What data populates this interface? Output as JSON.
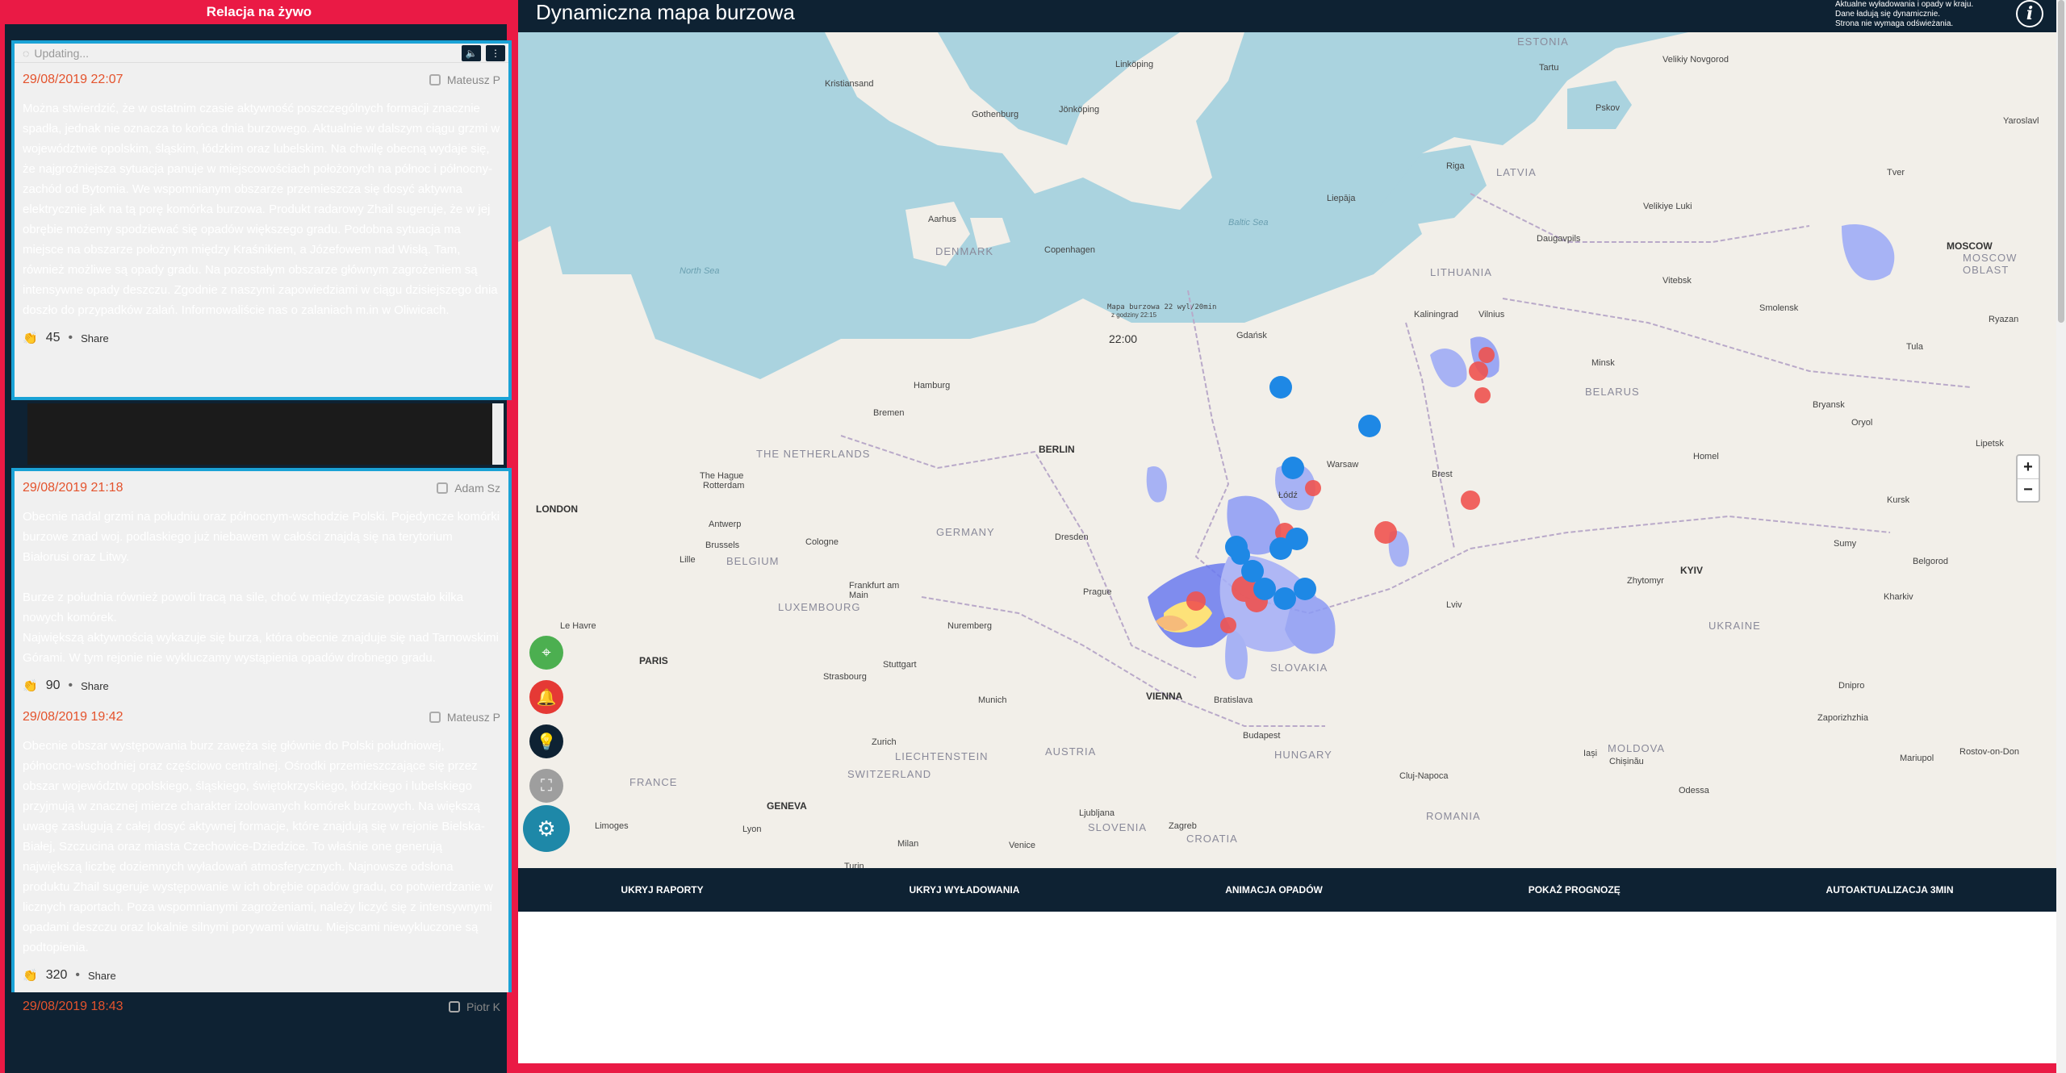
{
  "live": {
    "header": "Relacja na żywo",
    "updating": "Updating...",
    "posts_top": [
      {
        "date": "29/08/2019 22:07",
        "author": "Mateusz P",
        "body": "Można stwierdzić, że w ostatnim czasie aktywność poszczególnych formacji znacznie spadła, jednak nie oznacza to końca dnia burzowego. Aktualnie w dalszym ciągu grzmi w województwie opolskim, śląskim, łódzkim oraz lubelskim. Na chwilę obecną wydaje się, że najgroźniejsza sytuacja panuje w miejscowościach położonych na północ i północny-zachód od Bytomia. We wspomnianym obszarze przemieszcza się dosyć aktywna elektrycznie jak na tą porę komórka burzowa. Produkt radarowy Zhail sugeruje, że w jej obrębie możemy spodziewać się opadów większego gradu. Podobna sytuacja ma miejsce na obszarze położnym między Kraśnikiem, a Józefowem nad Wisłą. Tam, również możliwe są opady gradu. Na pozostałym obszarze głównym zagrożeniem są intensywne opady deszczu. Zgodnie z naszymi zapowiedziami w ciągu dzisiejszego dnia doszło do przypadków zalań. Informowaliście nas o zalaniach m.in w Oliwicach.",
        "claps": "45",
        "share": "Share"
      }
    ],
    "posts_bottom": [
      {
        "date": "29/08/2019 21:18",
        "author": "Adam Sz",
        "body": "Obecnie nadal grzmi na południu oraz północnym-wschodzie Polski. Pojedyncze komórki burzowe znad woj. podlaskiego już niebawem w całości znajdą się na terytorium Białorusi oraz Litwy.\n\nBurze z południa również powoli tracą na sile, choć w międzyczasie powstało kilka nowych komórek.\nNajwiększą aktywnością wykazuje się burza, która obecnie znajduje się nad Tarnowskimi Górami. W tym rejonie nie wykluczamy wystąpienia opadów drobnego gradu.",
        "claps": "90",
        "share": "Share"
      },
      {
        "date": "29/08/2019 19:42",
        "author": "Mateusz P",
        "body": "Obecnie obszar występowania burz zawęża się głównie do Polski południowej, północno-wschodniej oraz częściowo centralnej. Ośrodki przemieszczające się przez obszar województw opolskiego, śląskiego, świętokrzyskiego, łódzkiego i lubelskiego przyjmują w znacznej mierze charakter izolowanych komórek burzowych. Na większą uwagę zasługują z całej dosyć aktywnej formacje, które znajdują się w rejonie Bielska-Białej, Szczucina oraz miasta Czechowice-Dziedzice. To właśnie one generują największą liczbę doziemnych wyładowań atmosferycznych. Najnowsze odsłona produktu Zhail sugeruje występowanie w ich obrębie opadów gradu, co potwierdzanie w licznych raportach. Poza wspomnianymi zagrożeniami, należy liczyć się z intensywnymi opadami deszczu oraz lokalnie silnymi porywami wiatru. Miejscami niewykluczone są podtopienia.",
        "claps": "320",
        "share": "Share"
      },
      {
        "date": "29/08/2019 18:43",
        "author": "Piotr K"
      }
    ]
  },
  "map": {
    "title": "Dynamiczna mapa burzowa",
    "note": [
      "Aktualne wyładowania i opady w kraju.",
      "Dane ładują się dynamicznie.",
      "Strona nie wymaga odświeżania."
    ],
    "info_icon": "i",
    "overlay_title": "Mapa burzowa 22 wyl/20min",
    "overlay_sub": "z godziny 22:15",
    "overlay_time": "22:00",
    "zoom_in": "+",
    "zoom_out": "−",
    "bottom_buttons": [
      "UKRYJ RAPORTY",
      "UKRYJ WYŁADOWANIA",
      "ANIMACJA OPADÓW",
      "POKAŻ PROGNOZĘ",
      "AUTOAKTUALIZACJA 3MIN"
    ],
    "countries": [
      "ESTONIA",
      "LATVIA",
      "LITHUANIA",
      "BELARUS",
      "DENMARK",
      "THE NETHERLANDS",
      "BELGIUM",
      "LUXEMBOURG",
      "GERMANY",
      "FRANCE",
      "SWITZERLAND",
      "LIECHTENSTEIN",
      "AUSTRIA",
      "SLOVENIA",
      "CROATIA",
      "HUNGARY",
      "SLOVAKIA",
      "ROMANIA",
      "UKRAINE",
      "MOLDOVA",
      "MOSCOW OBLAST",
      "KYIV"
    ],
    "seas": [
      "North Sea",
      "Baltic Sea"
    ],
    "cities": [
      "Kristiansand",
      "Linköping",
      "Jönköping",
      "Gothenburg",
      "Aarhus",
      "Copenhagen",
      "Hamburg",
      "Bremen",
      "BERLIN",
      "The Hague",
      "Rotterdam",
      "LONDON",
      "Antwerp",
      "Brussels",
      "Lille",
      "Cologne",
      "Frankfurt am Main",
      "Dresden",
      "Prague",
      "Nuremberg",
      "Stuttgart",
      "Strasbourg",
      "Munich",
      "Zurich",
      "GENEVA",
      "Lyon",
      "Milan",
      "Venice",
      "Ljubljana",
      "Zagreb",
      "VIENNA",
      "Bratislava",
      "Budapest",
      "PARIS",
      "Le Havre",
      "Limoges",
      "Turin",
      "Gdańsk",
      "Kaliningrad",
      "Warsaw",
      "Łódź",
      "Brest",
      "Lviv",
      "Minsk",
      "Vilnius",
      "Riga",
      "Tartu",
      "Pskov",
      "Velikiye Luki",
      "Daugavpils",
      "Vitebsk",
      "Smolensk",
      "Bryansk",
      "Homel",
      "Zhytomyr",
      "Kharkiv",
      "Sumy",
      "Kursk",
      "Belgorod",
      "Cluj-Napoca",
      "Odessa",
      "Chișinău",
      "Iași",
      "Dnipro",
      "Zaporizhzhia",
      "Mariupol",
      "Rostov-on-Don",
      "Lipetsk",
      "Oryol",
      "Tula",
      "Ryazan",
      "Velikiy Novgorod",
      "MOSCOW",
      "Yaroslavl",
      "Tver",
      "Liepāja"
    ]
  }
}
